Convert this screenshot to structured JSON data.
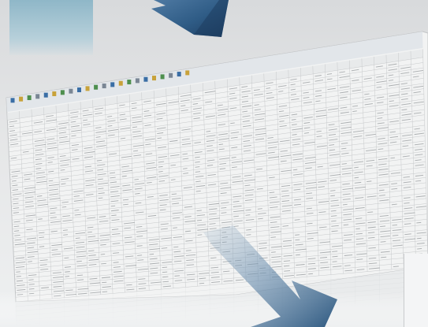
{
  "card": {
    "text": ""
  },
  "spreadsheet": {
    "columns": 34,
    "rows": 40
  },
  "colors": {
    "background": "#dfe1e3",
    "arrow": "#2f5c86",
    "arrow_dark": "#1f3f63",
    "sheet": "#f3f3f3",
    "grid": "#c7c9cb",
    "text_lines": "#6f7478",
    "toolbar": "#e2e6ea"
  }
}
